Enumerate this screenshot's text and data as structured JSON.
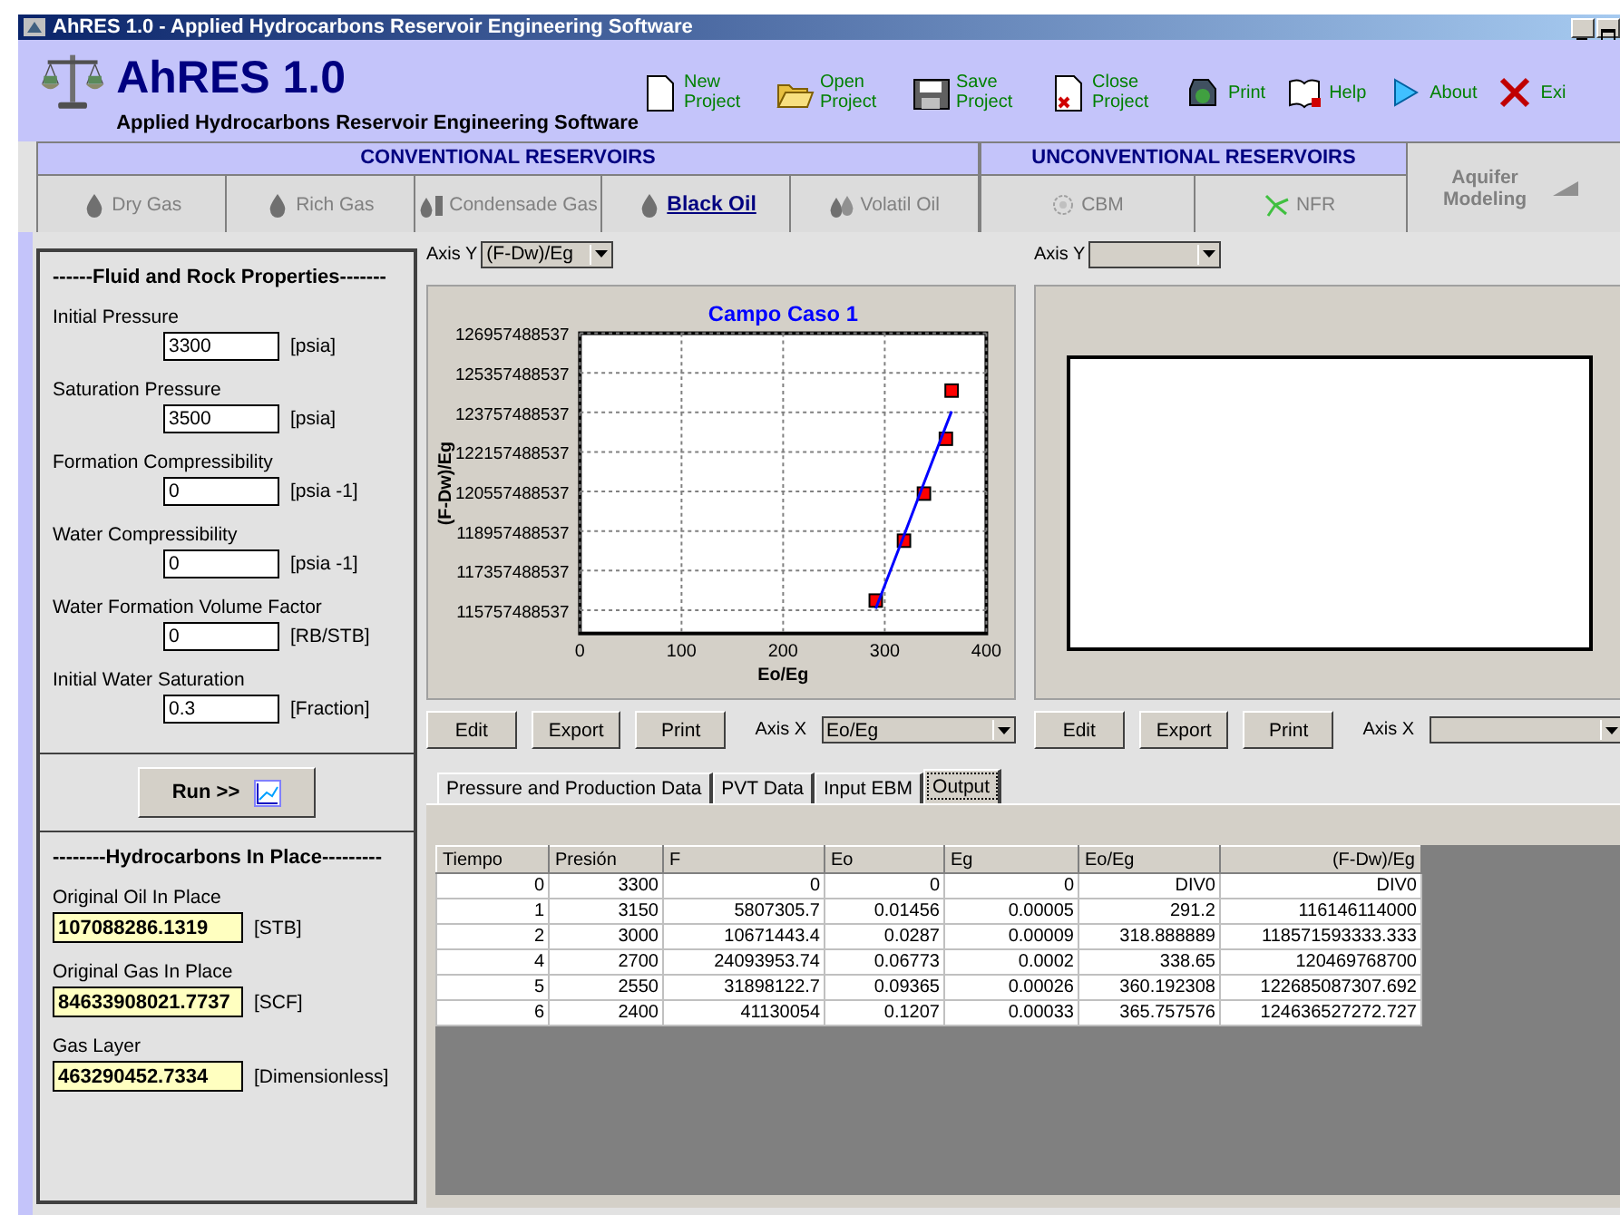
{
  "window": {
    "title": "AhRES 1.0 - Applied Hydrocarbons Reservoir Engineering Software"
  },
  "app": {
    "name": "AhRES 1.0",
    "subtitle": "Applied Hydrocarbons Reservoir Engineering Software"
  },
  "toolbar": [
    {
      "label": "New Project",
      "kind": "new"
    },
    {
      "label": "Open Project",
      "kind": "open"
    },
    {
      "label": "Save Project",
      "kind": "save"
    },
    {
      "label": "Close Project",
      "kind": "close"
    },
    {
      "label": "Print",
      "kind": "print"
    },
    {
      "label": "Help",
      "kind": "help"
    },
    {
      "label": "About",
      "kind": "about"
    },
    {
      "label": "Exi",
      "kind": "exit"
    }
  ],
  "sections": [
    {
      "label": "CONVENTIONAL RESERVOIRS",
      "tabs": [
        {
          "label": "Dry Gas",
          "kind": "drop",
          "selected": false
        },
        {
          "label": "Rich Gas",
          "kind": "drop",
          "selected": false
        },
        {
          "label": "Condensade Gas",
          "kind": "condensate",
          "selected": false
        },
        {
          "label": "Black Oil",
          "kind": "drop",
          "selected": true
        },
        {
          "label": "Volatil Oil",
          "kind": "drops",
          "selected": false
        }
      ]
    },
    {
      "label": "UNCONVENTIONAL RESERVOIRS",
      "tabs": [
        {
          "label": "CBM",
          "kind": "cbm",
          "selected": false
        },
        {
          "label": "NFR",
          "kind": "nfr",
          "selected": false
        }
      ]
    }
  ],
  "aquifer": {
    "label": "Aquifer Modeling"
  },
  "fluid_rock": {
    "title": "------Fluid and Rock Properties-------",
    "fields": [
      {
        "label": "Initial Pressure",
        "value": "3300",
        "unit": "[psia]"
      },
      {
        "label": "Saturation Pressure",
        "value": "3500",
        "unit": "[psia]"
      },
      {
        "label": "Formation Compressibility",
        "value": "0",
        "unit": "[psia -1]"
      },
      {
        "label": "Water Compressibility",
        "value": "0",
        "unit": "[psia -1]"
      },
      {
        "label": "Water Formation Volume Factor",
        "value": "0",
        "unit": "[RB/STB]"
      },
      {
        "label": "Initial Water Saturation",
        "value": "0.3",
        "unit": "[Fraction]"
      }
    ]
  },
  "run_button": {
    "label": "Run  >>"
  },
  "in_place": {
    "title": "--------Hydrocarbons In Place---------",
    "fields": [
      {
        "label": "Original Oil In Place",
        "value": "107088286.1319",
        "unit": "[STB]"
      },
      {
        "label": "Original Gas In Place",
        "value": "84633908021.7737",
        "unit": "[SCF]"
      },
      {
        "label": "Gas Layer",
        "value": "463290452.7334",
        "unit": "[Dimensionless]"
      }
    ]
  },
  "charts": [
    {
      "axis_y": {
        "label": "Axis Y",
        "value": "(F-Dw)/Eg"
      },
      "axis_x": {
        "label": "Axis X",
        "value": "Eo/Eg"
      },
      "buttons": [
        "Edit",
        "Export",
        "Print"
      ],
      "chart_data": {
        "type": "scatter",
        "title": "Campo Caso 1",
        "xlabel": "Eo/Eg",
        "ylabel": "(F-Dw)/Eg",
        "x": [
          291.2,
          318.888889,
          338.65,
          360.192308,
          365.757576
        ],
        "series": [
          {
            "color": "#ff0000",
            "values": [
              116150000000,
              118570000000,
              120470000000,
              122690000000,
              124640000000
            ]
          },
          {
            "type": "line",
            "color": "#0000ff",
            "values": [
              115820000000,
              118780000000,
              120900000000,
              123210000000,
              123800000000
            ]
          }
        ],
        "grid": true,
        "xlim": [
          0,
          400
        ],
        "ylim": [
          114817488537,
          126957488537
        ],
        "xticks": [
          0,
          100,
          200,
          300,
          400
        ],
        "yticks": [
          115757488537,
          117357488537,
          118957488537,
          120557488537,
          122157488537,
          123757488537,
          125357488537,
          126957488537
        ]
      }
    },
    {
      "axis_y": {
        "label": "Axis Y"
      },
      "axis_x": {
        "label": "Axis X"
      },
      "buttons": [
        "Edit",
        "Export",
        "Print"
      ]
    }
  ],
  "data_tabs": [
    {
      "label": "Pressure and Production Data",
      "selected": false
    },
    {
      "label": "PVT Data",
      "selected": false
    },
    {
      "label": "Input EBM",
      "selected": false
    },
    {
      "label": "Output",
      "selected": true
    }
  ],
  "table": {
    "columns": [
      "Tiempo",
      "Presión",
      "F",
      "Eo",
      "Eg",
      "Eo/Eg",
      "(F-Dw)/Eg"
    ],
    "rows": [
      [
        "0",
        "3300",
        "0",
        "0",
        "0",
        "DIV0",
        "DIV0"
      ],
      [
        "1",
        "3150",
        "5807305.7",
        "0.01456",
        "0.00005",
        "291.2",
        "116146114000"
      ],
      [
        "2",
        "3000",
        "10671443.4",
        "0.0287",
        "0.00009",
        "318.888889",
        "118571593333.333"
      ],
      [
        "4",
        "2700",
        "24093953.74",
        "0.06773",
        "0.0002",
        "338.65",
        "120469768700"
      ],
      [
        "5",
        "2550",
        "31898122.7",
        "0.09365",
        "0.00026",
        "360.192308",
        "122685087307.692"
      ],
      [
        "6",
        "2400",
        "41130054",
        "0.1207",
        "0.00033",
        "365.757576",
        "124636527272.727"
      ]
    ]
  }
}
